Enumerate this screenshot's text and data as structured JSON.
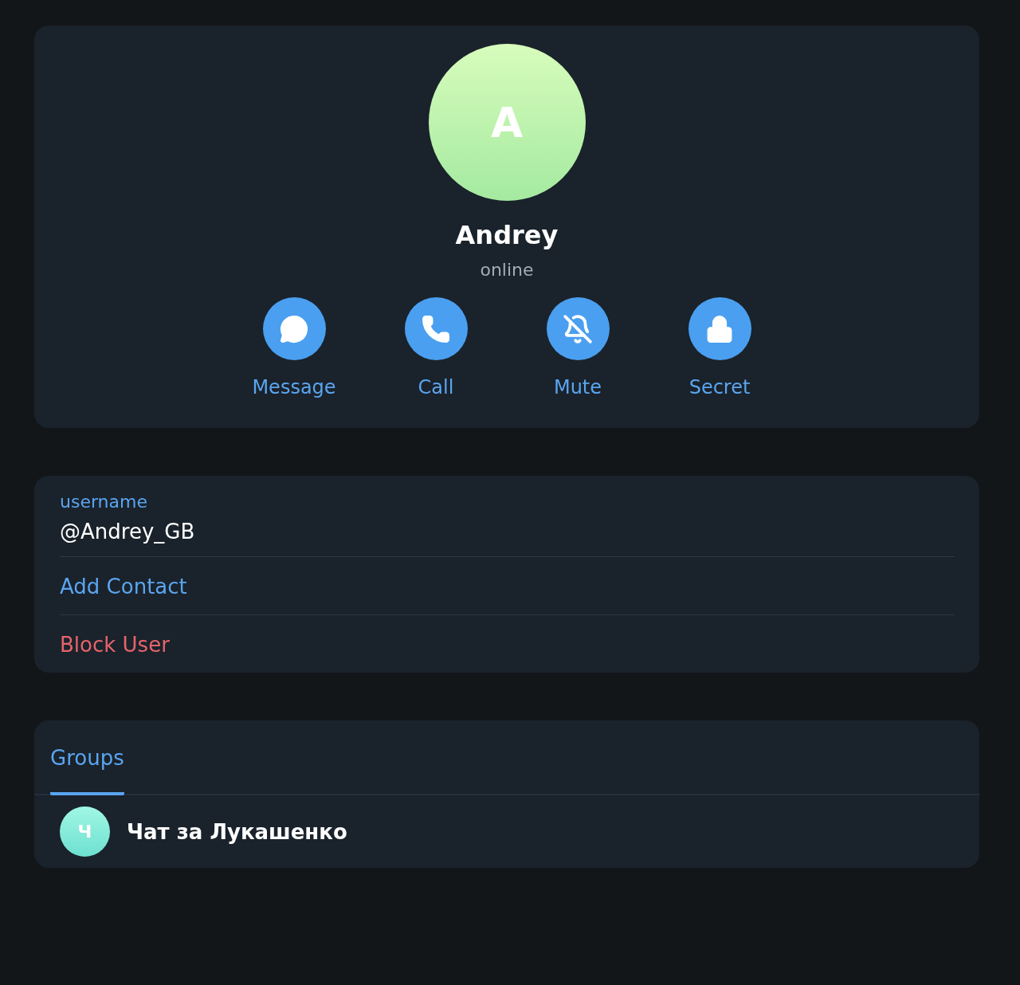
{
  "profile": {
    "avatar_letter": "A",
    "name": "Andrey",
    "status": "online"
  },
  "actions": [
    {
      "kind": "message",
      "label": "Message"
    },
    {
      "kind": "call",
      "label": "Call"
    },
    {
      "kind": "mute",
      "label": "Mute"
    },
    {
      "kind": "secret",
      "label": "Secret"
    }
  ],
  "details": [
    {
      "kind": "field",
      "label": "username",
      "value": "@Andrey_GB"
    },
    {
      "kind": "link",
      "label": "Add Contact"
    },
    {
      "kind": "danger",
      "label": "Block User"
    }
  ],
  "tabs": [
    {
      "label": "Groups",
      "selected": true
    }
  ],
  "groups": [
    {
      "avatar_letter": "Ч",
      "name": "Чат за Лукашенко"
    }
  ]
}
